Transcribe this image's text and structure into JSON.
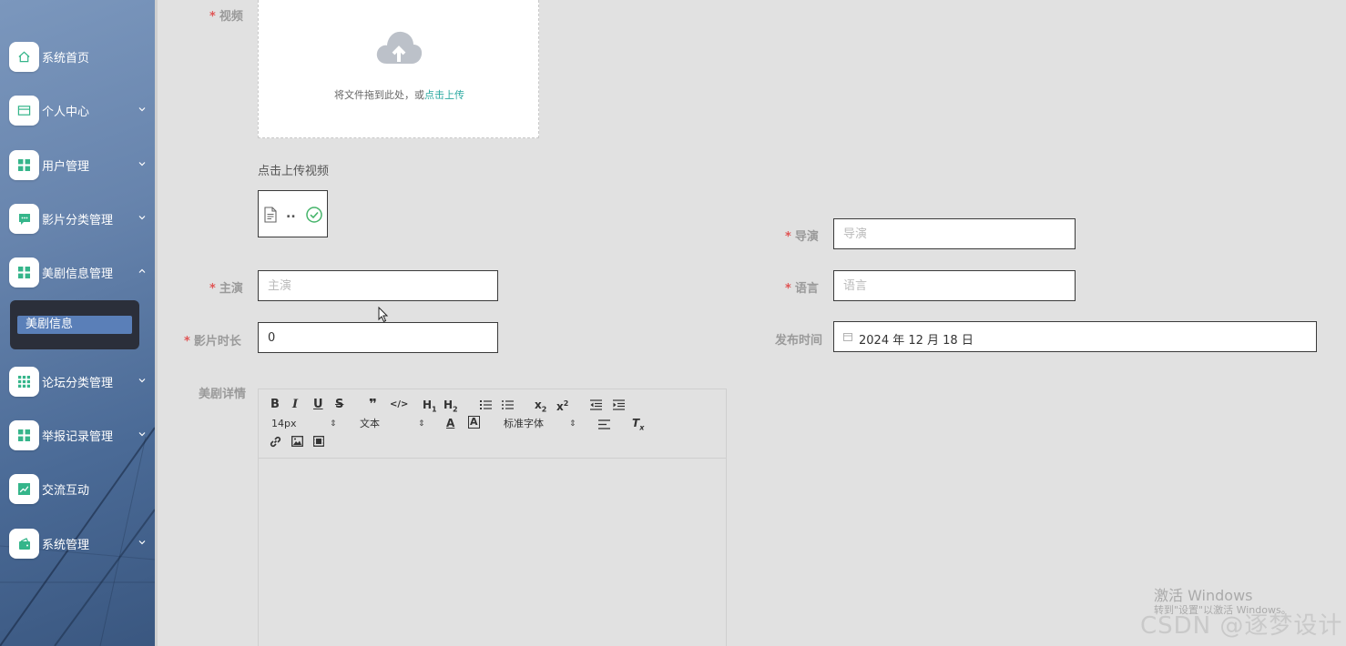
{
  "sidebar": {
    "items": [
      {
        "label": "系统首页",
        "icon": "home-icon",
        "expandable": false
      },
      {
        "label": "个人中心",
        "icon": "card-icon",
        "expandable": true
      },
      {
        "label": "用户管理",
        "icon": "grid-icon",
        "expandable": true
      },
      {
        "label": "影片分类管理",
        "icon": "chat-icon",
        "expandable": true
      },
      {
        "label": "美剧信息管理",
        "icon": "grid-icon",
        "expandable": true,
        "expanded": true
      },
      {
        "label": "论坛分类管理",
        "icon": "apps-icon",
        "expandable": true
      },
      {
        "label": "举报记录管理",
        "icon": "grid-icon",
        "expandable": true
      },
      {
        "label": "交流互动",
        "icon": "chart-icon",
        "expandable": false
      },
      {
        "label": "系统管理",
        "icon": "wallet-icon",
        "expandable": true
      }
    ],
    "submenu": {
      "label": "美剧信息"
    },
    "accent": "#35b58a"
  },
  "form": {
    "video": {
      "label": "视频",
      "upload_text": "将文件拖到此处，或",
      "upload_link": "点击上传",
      "tip": "点击上传视频",
      "file_name": ".."
    },
    "director": {
      "label": "导演",
      "placeholder": "导演",
      "value": ""
    },
    "actor": {
      "label": "主演",
      "placeholder": "主演",
      "value": ""
    },
    "language": {
      "label": "语言",
      "placeholder": "语言",
      "value": ""
    },
    "duration": {
      "label": "影片时长",
      "value": "0"
    },
    "publish": {
      "label": "发布时间",
      "value": "2024 年 12 月 18 日"
    },
    "details": {
      "label": "美剧详情",
      "font_size": "14px",
      "text_type": "文本",
      "font_family": "标准字体"
    }
  },
  "watermark": {
    "line1": "激活 Windows",
    "line2": "转到\"设置\"以激活 Windows。",
    "csdn": "CSDN @逐梦设计"
  }
}
